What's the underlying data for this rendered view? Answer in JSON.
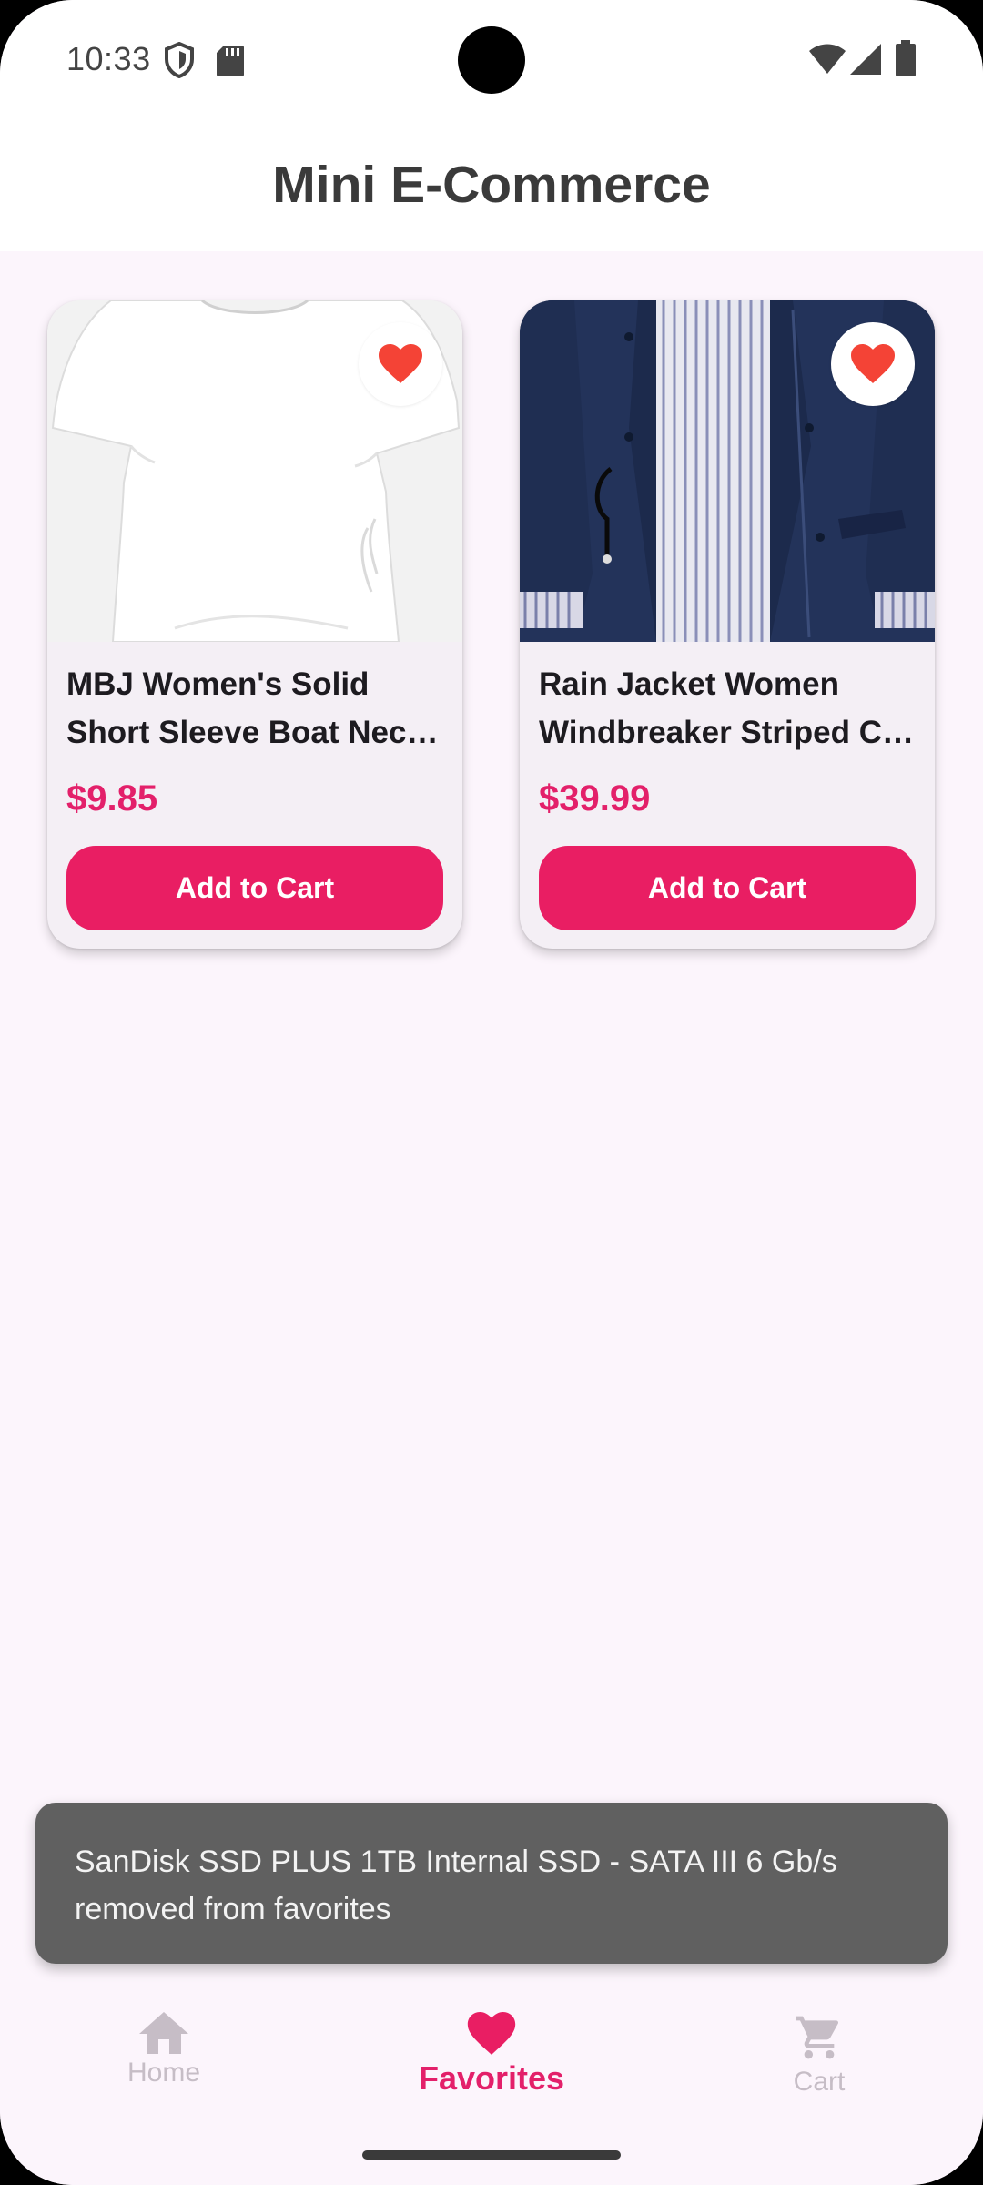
{
  "status_bar": {
    "time": "10:33"
  },
  "app_bar": {
    "title": "Mini E-Commerce"
  },
  "products": [
    {
      "title_line1": "MBJ Women's Solid",
      "title_line2": "Short Sleeve Boat Neck V",
      "price": "$9.85",
      "button_label": "Add to Cart",
      "favorited": true
    },
    {
      "title_line1": "Rain Jacket Women",
      "title_line2": "Windbreaker Striped Climbing",
      "price": "$39.99",
      "button_label": "Add to Cart",
      "favorited": true
    }
  ],
  "snackbar": {
    "message": "SanDisk SSD PLUS 1TB Internal SSD - SATA III 6 Gb/s removed from favorites"
  },
  "bottom_nav": {
    "items": [
      {
        "label": "Home",
        "icon": "home-icon",
        "active": false
      },
      {
        "label": "Favorites",
        "icon": "heart-icon",
        "active": true
      },
      {
        "label": "Cart",
        "icon": "cart-icon",
        "active": false
      }
    ]
  },
  "colors": {
    "accent": "#e91e63",
    "price": "#e3206a",
    "favorite_heart": "#f44336",
    "background": "#fcf5fc",
    "card": "#f4eff5",
    "snackbar": "#606060"
  }
}
